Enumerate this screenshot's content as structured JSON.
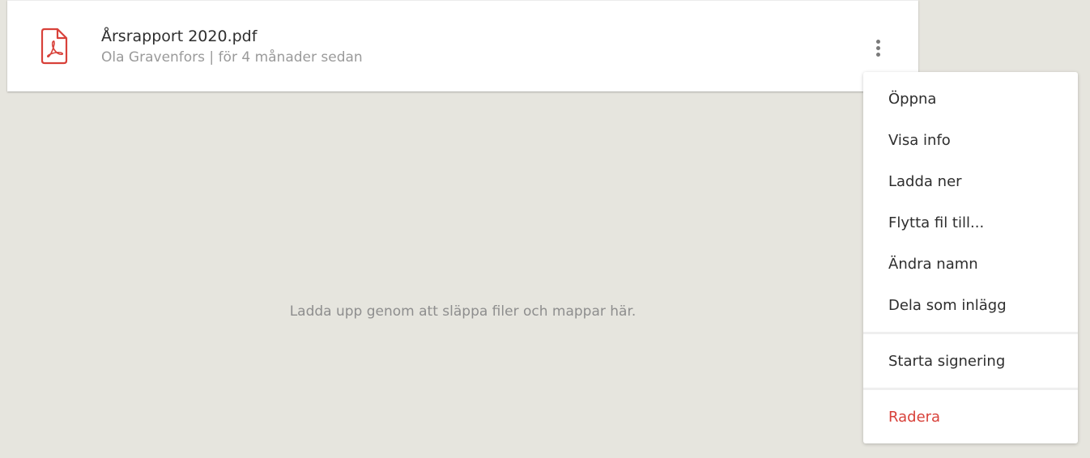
{
  "file": {
    "name": "Årsrapport 2020.pdf",
    "meta": "Ola Gravenfors | för 4 månader sedan",
    "icon": "pdf-file-icon",
    "icon_color": "#d8413a"
  },
  "dropzone": {
    "hint": "Ladda upp genom att släppa filer och mappar här."
  },
  "context_menu": {
    "items": [
      {
        "label": "Öppna"
      },
      {
        "label": "Visa info"
      },
      {
        "label": "Ladda ner"
      },
      {
        "label": "Flytta fil till..."
      },
      {
        "label": "Ändra namn"
      },
      {
        "label": "Dela som inlägg"
      },
      {
        "label": "Starta signering"
      },
      {
        "label": "Radera",
        "color": "#d8413a"
      }
    ]
  },
  "colors": {
    "background": "#e6e5de",
    "card": "#ffffff",
    "danger": "#d8413a"
  }
}
